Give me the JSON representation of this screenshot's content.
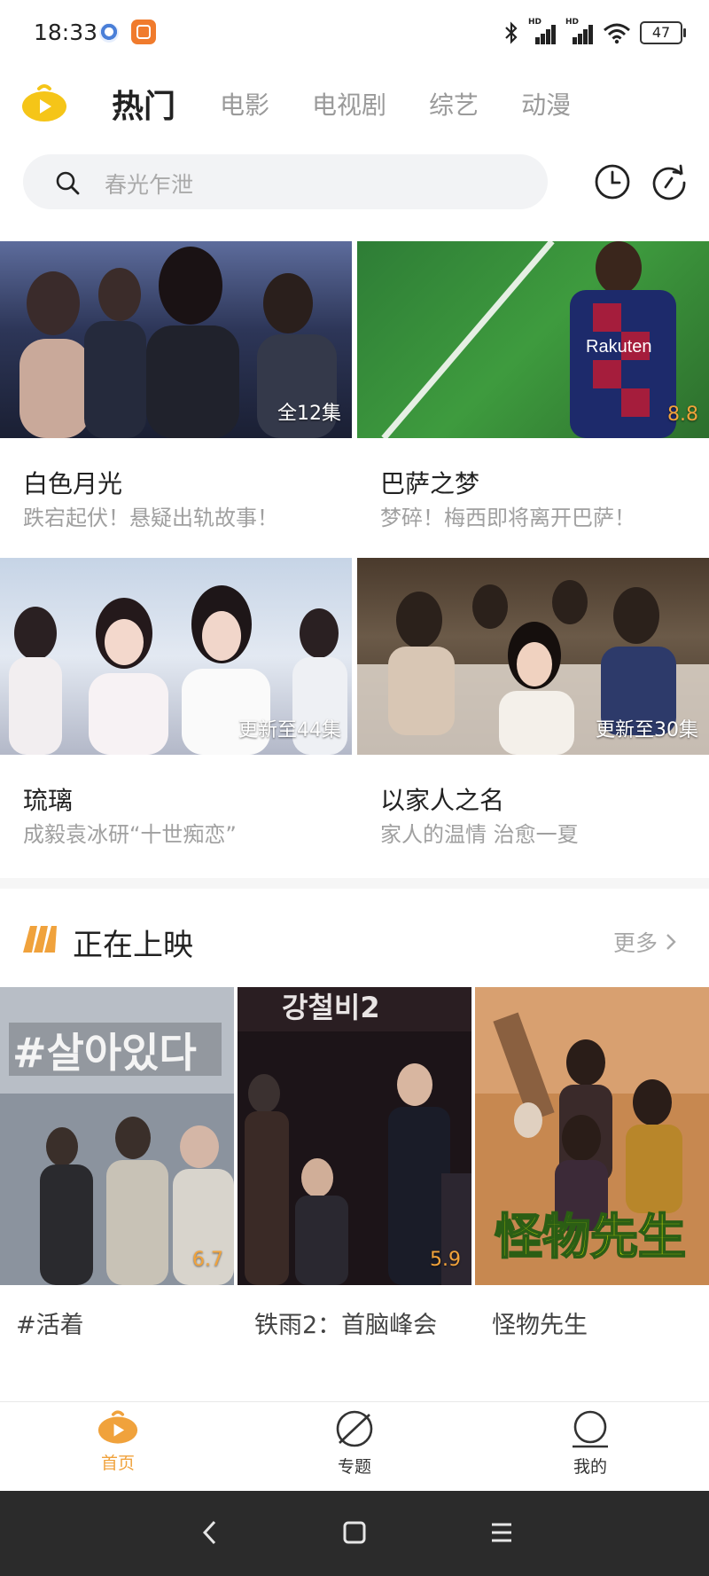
{
  "status_bar": {
    "time": "18:33",
    "battery": "47",
    "signal_label": "HD"
  },
  "top_tabs": [
    "热门",
    "电影",
    "电视剧",
    "综艺",
    "动漫"
  ],
  "search": {
    "placeholder": "春光乍泄"
  },
  "featured": [
    {
      "title": "白色月光",
      "subtitle": "跌宕起伏！悬疑出轨故事！",
      "badge": "全12集",
      "badge_type": "episodes"
    },
    {
      "title": "巴萨之梦",
      "subtitle": "梦碎！梅西即将离开巴萨！",
      "badge": "8.8",
      "badge_type": "rating"
    },
    {
      "title": "琉璃",
      "subtitle": "成毅袁冰研“十世痴恋”",
      "badge": "更新至44集",
      "badge_type": "episodes"
    },
    {
      "title": "以家人之名",
      "subtitle": "家人的温情 治愈一夏",
      "badge": "更新至30集",
      "badge_type": "episodes"
    }
  ],
  "now_showing": {
    "title": "正在上映",
    "more": "更多",
    "movies": [
      {
        "title": "#活着",
        "rating": "6.7"
      },
      {
        "title": "铁雨2：首脑峰会",
        "rating": "5.9"
      },
      {
        "title": "怪物先生",
        "rating": ""
      }
    ]
  },
  "bottom_nav": [
    {
      "label": "首页",
      "active": true
    },
    {
      "label": "专题",
      "active": false
    },
    {
      "label": "我的",
      "active": false
    }
  ],
  "colors": {
    "accent": "#f0a23c",
    "logo": "#f5c518"
  }
}
